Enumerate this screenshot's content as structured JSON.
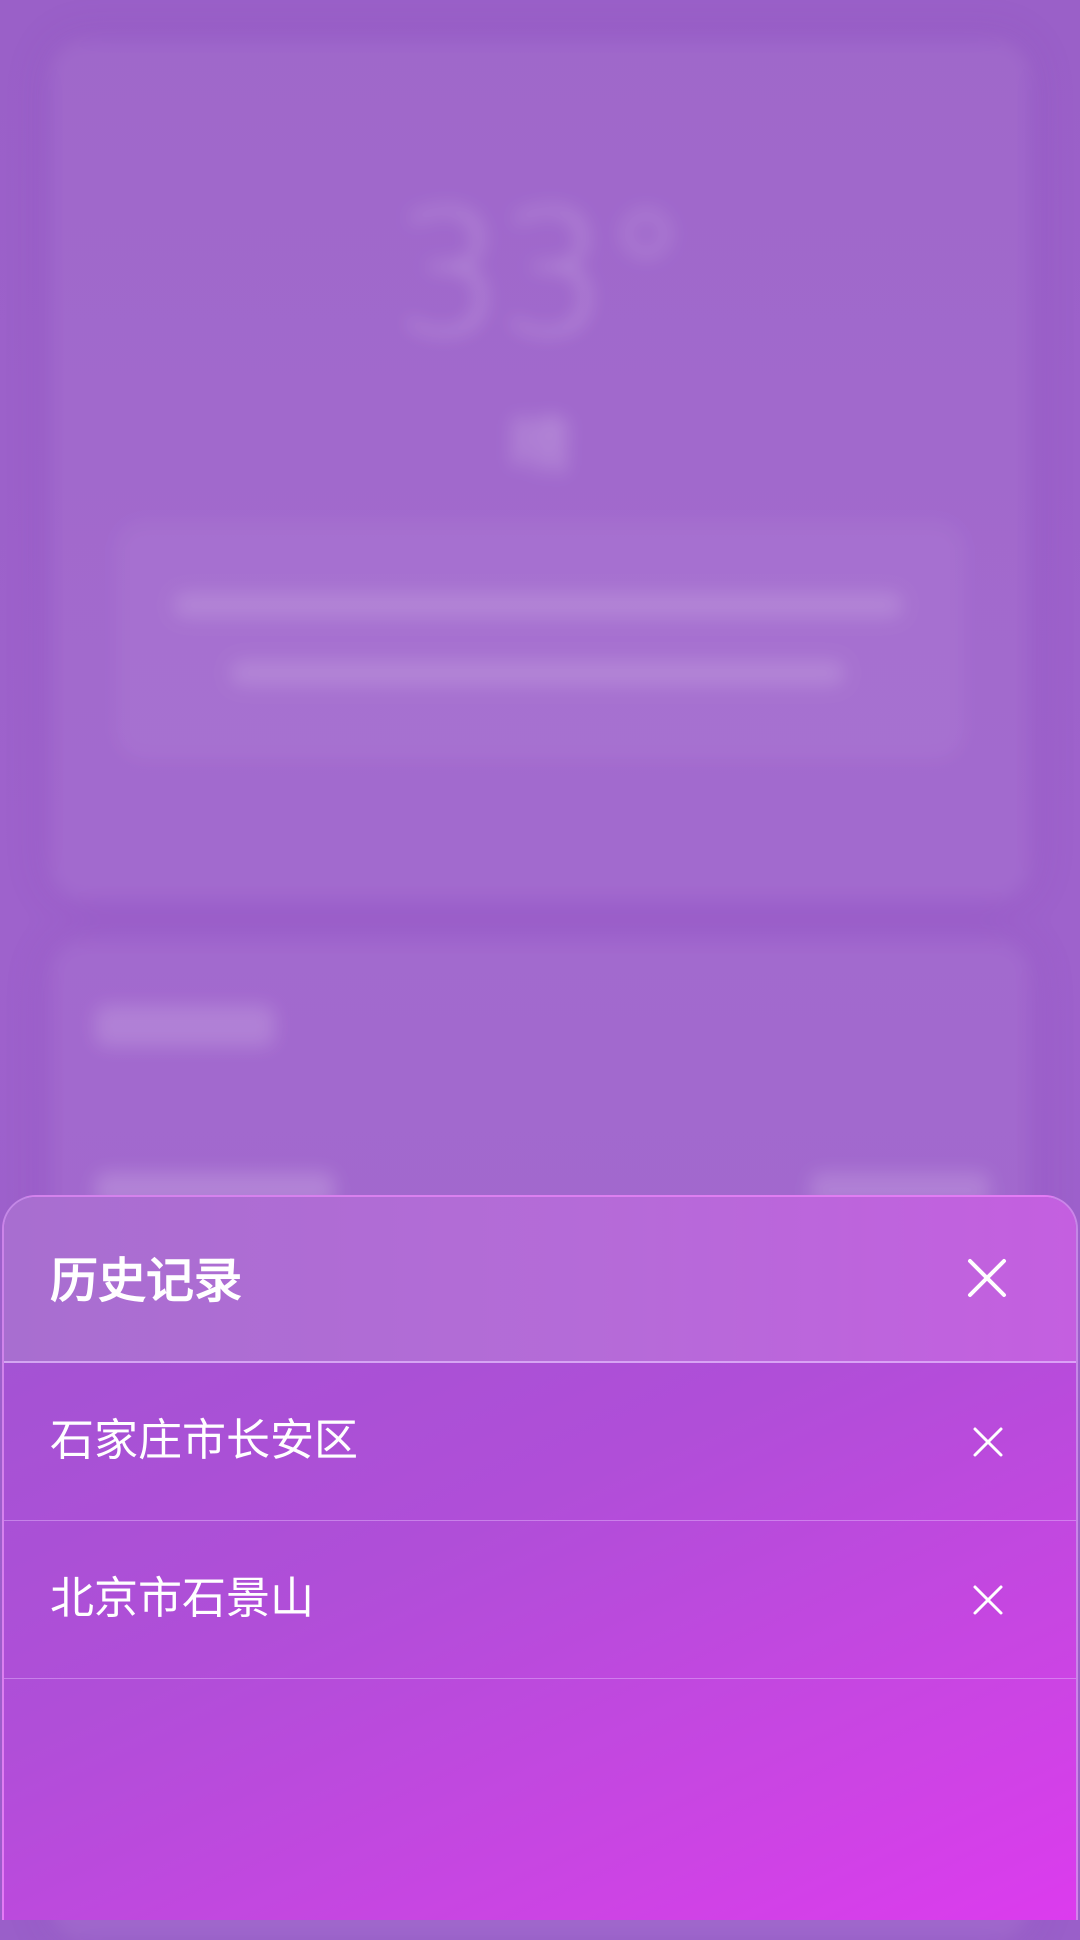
{
  "background": {
    "temperature": "33°",
    "condition": "晴"
  },
  "history_sheet": {
    "title": "历史记录",
    "close_icon": "close-icon",
    "items": [
      {
        "label": "石家庄市长安区",
        "delete_icon": "close-icon"
      },
      {
        "label": "北京市石景山",
        "delete_icon": "close-icon"
      }
    ]
  },
  "colors": {
    "background": "#9a5fc9",
    "sheet_start": "#9f55d2",
    "sheet_end": "#dc3bee",
    "text": "#ffffff"
  }
}
